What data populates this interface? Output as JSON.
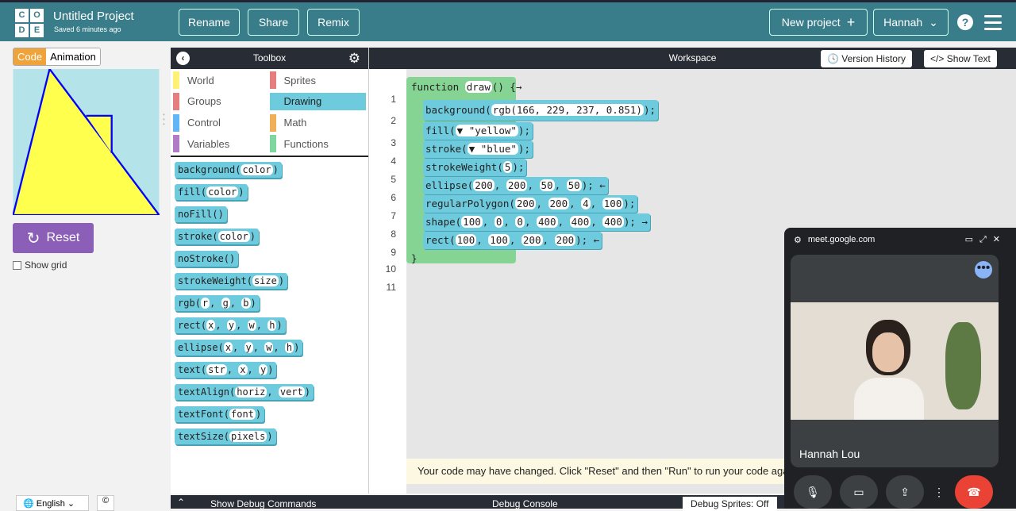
{
  "header": {
    "logo": [
      "C",
      "O",
      "D",
      "E"
    ],
    "title": "Untitled Project",
    "saved": "Saved 6 minutes ago",
    "rename": "Rename",
    "share": "Share",
    "remix": "Remix",
    "new_project": "New project",
    "new_project_icon": "+",
    "user": "Hannah",
    "help": "?"
  },
  "left": {
    "tab_code": "Code",
    "tab_animation": "Animation",
    "reset": "Reset",
    "show_grid": "Show grid",
    "language": "English",
    "cc": "©"
  },
  "toolbox": {
    "title": "Toolbox",
    "categories": [
      {
        "label": "World",
        "color": "#fff176"
      },
      {
        "label": "Sprites",
        "color": "#e57f7f"
      },
      {
        "label": "Groups",
        "color": "#e57f7f"
      },
      {
        "label": "Drawing",
        "color": "#6ecbdd"
      },
      {
        "label": "Control",
        "color": "#64b5f6"
      },
      {
        "label": "Math",
        "color": "#f0b05a"
      },
      {
        "label": "Variables",
        "color": "#b07cc6"
      },
      {
        "label": "Functions",
        "color": "#7ed6a0"
      }
    ],
    "blocks": [
      {
        "name": "background",
        "args": [
          "color"
        ]
      },
      {
        "name": "fill",
        "args": [
          "color"
        ]
      },
      {
        "name": "noFill",
        "args": []
      },
      {
        "name": "stroke",
        "args": [
          "color"
        ]
      },
      {
        "name": "noStroke",
        "args": []
      },
      {
        "name": "strokeWeight",
        "args": [
          "size"
        ]
      },
      {
        "name": "rgb",
        "args": [
          "r",
          "g",
          "b"
        ]
      },
      {
        "name": "rect",
        "args": [
          "x",
          "y",
          "w",
          "h"
        ]
      },
      {
        "name": "ellipse",
        "args": [
          "x",
          "y",
          "w",
          "h"
        ]
      },
      {
        "name": "text",
        "args": [
          "str",
          "x",
          "y"
        ]
      },
      {
        "name": "textAlign",
        "args": [
          "horiz",
          "vert"
        ]
      },
      {
        "name": "textFont",
        "args": [
          "font"
        ]
      },
      {
        "name": "textSize",
        "args": [
          "pixels"
        ]
      }
    ]
  },
  "workspace": {
    "title": "Workspace",
    "version_history": "Version History",
    "show_text": "Show Text",
    "line_numbers": [
      "1",
      "2",
      "3",
      "4",
      "5",
      "6",
      "7",
      "8",
      "9",
      "10",
      "11"
    ],
    "function_name": "draw",
    "function_kw": "function",
    "close": "}",
    "lines": [
      {
        "fn": "background",
        "args": [
          "rgb(166, 229, 237, 0.851)"
        ],
        "tail": ";"
      },
      {
        "fn": "fill",
        "args": [
          "▼ \"yellow\""
        ],
        "tail": ";"
      },
      {
        "fn": "stroke",
        "args": [
          "▼ \"blue\""
        ],
        "tail": ";"
      },
      {
        "fn": "strokeWeight",
        "args": [
          "5"
        ],
        "tail": ";"
      },
      {
        "fn": "ellipse",
        "args": [
          "200",
          "200",
          "50",
          "50"
        ],
        "tail": "; ←"
      },
      {
        "fn": "regularPolygon",
        "args": [
          "200",
          "200",
          "4",
          "100"
        ],
        "tail": ";"
      },
      {
        "fn": "shape",
        "args": [
          "100",
          "0",
          "0",
          "400",
          "400",
          "400"
        ],
        "tail": "; →"
      },
      {
        "fn": "rect",
        "args": [
          "100",
          "100",
          "200",
          "200"
        ],
        "tail": "; ←"
      }
    ],
    "notice": "Your code may have changed. Click \"Reset\" and then \"Run\" to run your code again."
  },
  "bottom": {
    "debug_commands": "Show Debug Commands",
    "console": "Debug Console",
    "sprites": "Debug Sprites: Off"
  },
  "meet": {
    "url": "meet.google.com",
    "name": "Hannah Lou"
  }
}
